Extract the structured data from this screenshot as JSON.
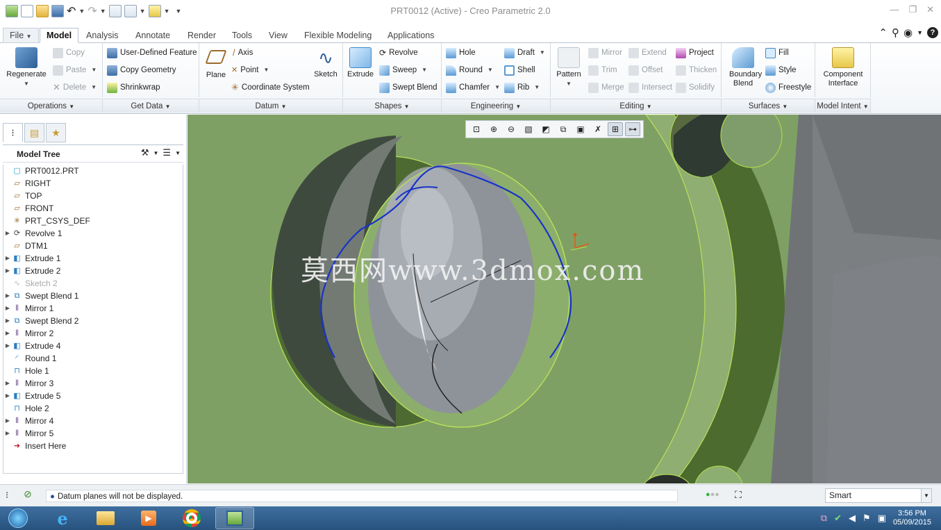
{
  "window": {
    "title": "PRT0012 (Active) - Creo Parametric 2.0"
  },
  "tabs": [
    "File",
    "Model",
    "Analysis",
    "Annotate",
    "Render",
    "Tools",
    "View",
    "Flexible Modeling",
    "Applications"
  ],
  "ribbon": {
    "operations": {
      "label": "Operations",
      "regenerate": "Regenerate",
      "copy": "Copy",
      "paste": "Paste",
      "delete": "Delete"
    },
    "get_data": {
      "label": "Get Data",
      "user_defined_feature": "User-Defined Feature",
      "copy_geometry": "Copy Geometry",
      "shrinkwrap": "Shrinkwrap"
    },
    "datum": {
      "label": "Datum",
      "plane": "Plane",
      "axis": "Axis",
      "point": "Point",
      "coordinate_system": "Coordinate System",
      "sketch": "Sketch"
    },
    "shapes": {
      "label": "Shapes",
      "extrude": "Extrude",
      "revolve": "Revolve",
      "sweep": "Sweep",
      "swept_blend": "Swept Blend"
    },
    "engineering": {
      "label": "Engineering",
      "hole": "Hole",
      "round": "Round",
      "chamfer": "Chamfer",
      "draft": "Draft",
      "shell": "Shell",
      "rib": "Rib"
    },
    "editing": {
      "label": "Editing",
      "pattern": "Pattern",
      "mirror": "Mirror",
      "trim": "Trim",
      "merge": "Merge",
      "extend": "Extend",
      "offset": "Offset",
      "intersect": "Intersect",
      "project": "Project",
      "thicken": "Thicken",
      "solidify": "Solidify"
    },
    "surfaces": {
      "label": "Surfaces",
      "boundary_blend": "Boundary Blend",
      "fill": "Fill",
      "style": "Style",
      "freestyle": "Freestyle"
    },
    "model_intent": {
      "label": "Model Intent",
      "component_interface": "Component Interface"
    }
  },
  "model_tree": {
    "header": "Model Tree",
    "items": [
      {
        "label": "PRT0012.PRT",
        "icon": "part-icon",
        "expandable": false,
        "dimmed": false
      },
      {
        "label": "RIGHT",
        "icon": "datum-plane-icon",
        "expandable": false,
        "dimmed": false
      },
      {
        "label": "TOP",
        "icon": "datum-plane-icon",
        "expandable": false,
        "dimmed": false
      },
      {
        "label": "FRONT",
        "icon": "datum-plane-icon",
        "expandable": false,
        "dimmed": false
      },
      {
        "label": "PRT_CSYS_DEF",
        "icon": "csys-icon",
        "expandable": false,
        "dimmed": false
      },
      {
        "label": "Revolve 1",
        "icon": "revolve-icon",
        "expandable": true,
        "dimmed": false
      },
      {
        "label": "DTM1",
        "icon": "datum-plane-icon",
        "expandable": false,
        "dimmed": false
      },
      {
        "label": "Extrude 1",
        "icon": "extrude-icon",
        "expandable": true,
        "dimmed": false
      },
      {
        "label": "Extrude 2",
        "icon": "extrude-icon",
        "expandable": true,
        "dimmed": false
      },
      {
        "label": "Sketch 2",
        "icon": "sketch-icon",
        "expandable": false,
        "dimmed": true
      },
      {
        "label": "Swept Blend 1",
        "icon": "swept-blend-icon",
        "expandable": true,
        "dimmed": false
      },
      {
        "label": "Mirror 1",
        "icon": "mirror-icon",
        "expandable": true,
        "dimmed": false
      },
      {
        "label": "Swept Blend 2",
        "icon": "swept-blend-icon",
        "expandable": true,
        "dimmed": false
      },
      {
        "label": "Mirror 2",
        "icon": "mirror-icon",
        "expandable": true,
        "dimmed": false
      },
      {
        "label": "Extrude 4",
        "icon": "extrude-icon",
        "expandable": true,
        "dimmed": false
      },
      {
        "label": "Round 1",
        "icon": "round-icon",
        "expandable": false,
        "dimmed": false
      },
      {
        "label": "Hole 1",
        "icon": "hole-icon",
        "expandable": false,
        "dimmed": false
      },
      {
        "label": "Mirror 3",
        "icon": "mirror-icon",
        "expandable": true,
        "dimmed": false
      },
      {
        "label": "Extrude 5",
        "icon": "extrude-icon",
        "expandable": true,
        "dimmed": false
      },
      {
        "label": "Hole 2",
        "icon": "hole-icon",
        "expandable": false,
        "dimmed": false
      },
      {
        "label": "Mirror 4",
        "icon": "mirror-icon",
        "expandable": true,
        "dimmed": false
      },
      {
        "label": "Mirror 5",
        "icon": "mirror-icon",
        "expandable": true,
        "dimmed": false
      },
      {
        "label": "Insert Here",
        "icon": "insert-here-arrow-icon",
        "expandable": false,
        "dimmed": false
      }
    ]
  },
  "viewport": {
    "watermark": "莫西网www.3dmox.com",
    "background": "#7fa064"
  },
  "status": {
    "message": "Datum planes will not be displayed.",
    "filter": "Smart"
  },
  "taskbar": {
    "time": "3:56 PM",
    "date": "05/09/2015"
  }
}
